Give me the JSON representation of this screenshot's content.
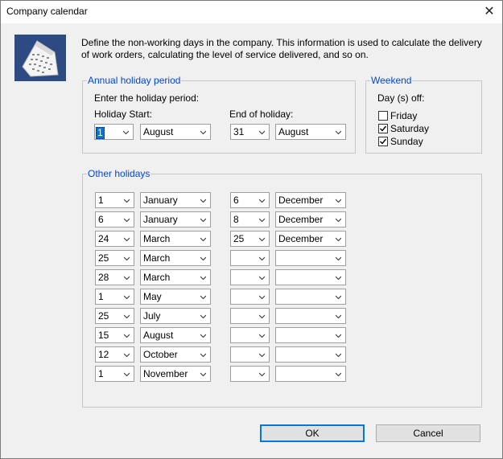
{
  "window": {
    "title": "Company calendar",
    "close_glyph": "✕"
  },
  "description": "Define the non-working days in the company. This information is used to calculate the delivery of work orders, calculating the level of service delivered, and so on.",
  "annual": {
    "legend": "Annual holiday period",
    "prompt": "Enter the holiday period:",
    "start_label": "Holiday Start:",
    "end_label": "End of holiday:",
    "start_day": "1",
    "start_month": "August",
    "end_day": "31",
    "end_month": "August"
  },
  "weekend": {
    "legend": "Weekend",
    "days_off_label": "Day (s) off:",
    "days": [
      {
        "label": "Friday",
        "checked": false
      },
      {
        "label": "Saturday",
        "checked": true
      },
      {
        "label": "Sunday",
        "checked": true
      }
    ]
  },
  "other": {
    "legend": "Other holidays",
    "rows": [
      {
        "sd": "1",
        "sm": "January",
        "ed": "6",
        "em": "December"
      },
      {
        "sd": "6",
        "sm": "January",
        "ed": "8",
        "em": "December"
      },
      {
        "sd": "24",
        "sm": "March",
        "ed": "25",
        "em": "December"
      },
      {
        "sd": "25",
        "sm": "March",
        "ed": "",
        "em": ""
      },
      {
        "sd": "28",
        "sm": "March",
        "ed": "",
        "em": ""
      },
      {
        "sd": "1",
        "sm": "May",
        "ed": "",
        "em": ""
      },
      {
        "sd": "25",
        "sm": "July",
        "ed": "",
        "em": ""
      },
      {
        "sd": "15",
        "sm": "August",
        "ed": "",
        "em": ""
      },
      {
        "sd": "12",
        "sm": "October",
        "ed": "",
        "em": ""
      },
      {
        "sd": "1",
        "sm": "November",
        "ed": "",
        "em": ""
      }
    ]
  },
  "buttons": {
    "ok": "OK",
    "cancel": "Cancel"
  },
  "colors": {
    "accent": "#0078d7",
    "legend": "#0046d5"
  }
}
